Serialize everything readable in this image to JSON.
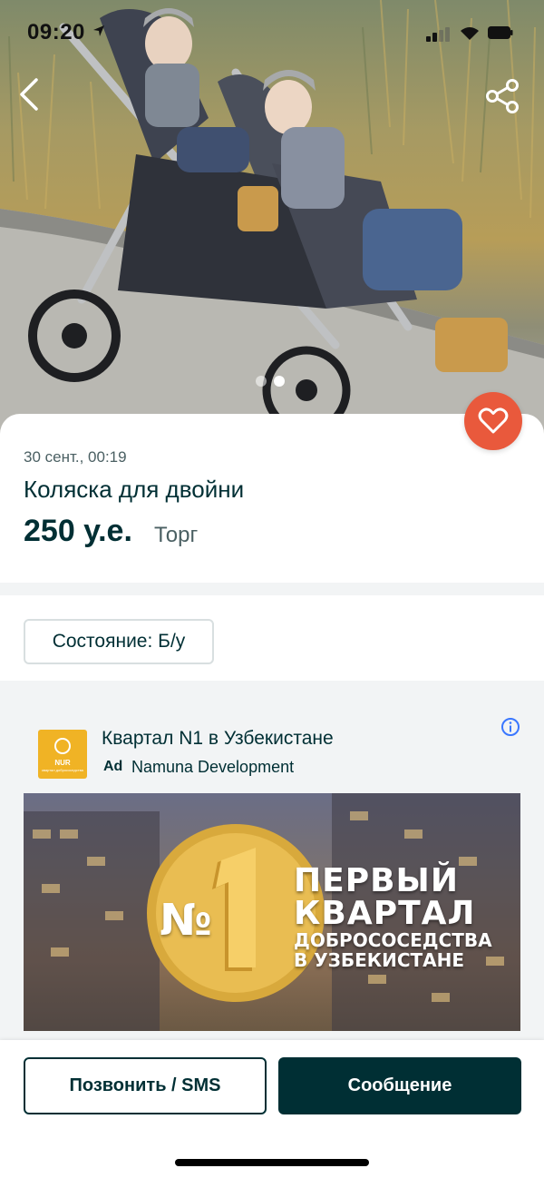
{
  "status_bar": {
    "time": "09:20"
  },
  "listing": {
    "date": "30 сент., 00:19",
    "title": "Коляска для двойни",
    "price": "250 у.е.",
    "negotiable": "Торг",
    "condition": "Состояние: Б/у",
    "gallery": {
      "photo_count": 2,
      "current_photo": 2
    }
  },
  "sponsored": {
    "headline": "Квартал N1 в Узбекистане",
    "ad_label": "Ad",
    "advertiser": "Namuna Development",
    "logo_text": "NUR",
    "logo_subtext": "квартал добрососедства",
    "banner": {
      "number_mark": "№",
      "number": "1",
      "line1": "ПЕРВЫЙ",
      "line2": "КВАРТАЛ",
      "line3": "ДОБРОСОСЕДСТВА",
      "line4": "В УЗБЕКИСТАНЕ"
    }
  },
  "actions": {
    "call_label": "Позвонить / SMS",
    "message_label": "Сообщение"
  },
  "icons": {
    "back": "chevron-left-icon",
    "share": "share-icon",
    "favorite": "heart-icon",
    "info": "info-icon"
  },
  "colors": {
    "brand_dark": "#002f34",
    "favorite_bg": "#e9593c",
    "section_bg": "#f2f4f5",
    "logo_bg": "#f0b325",
    "info_icon": "#3a77ff"
  }
}
